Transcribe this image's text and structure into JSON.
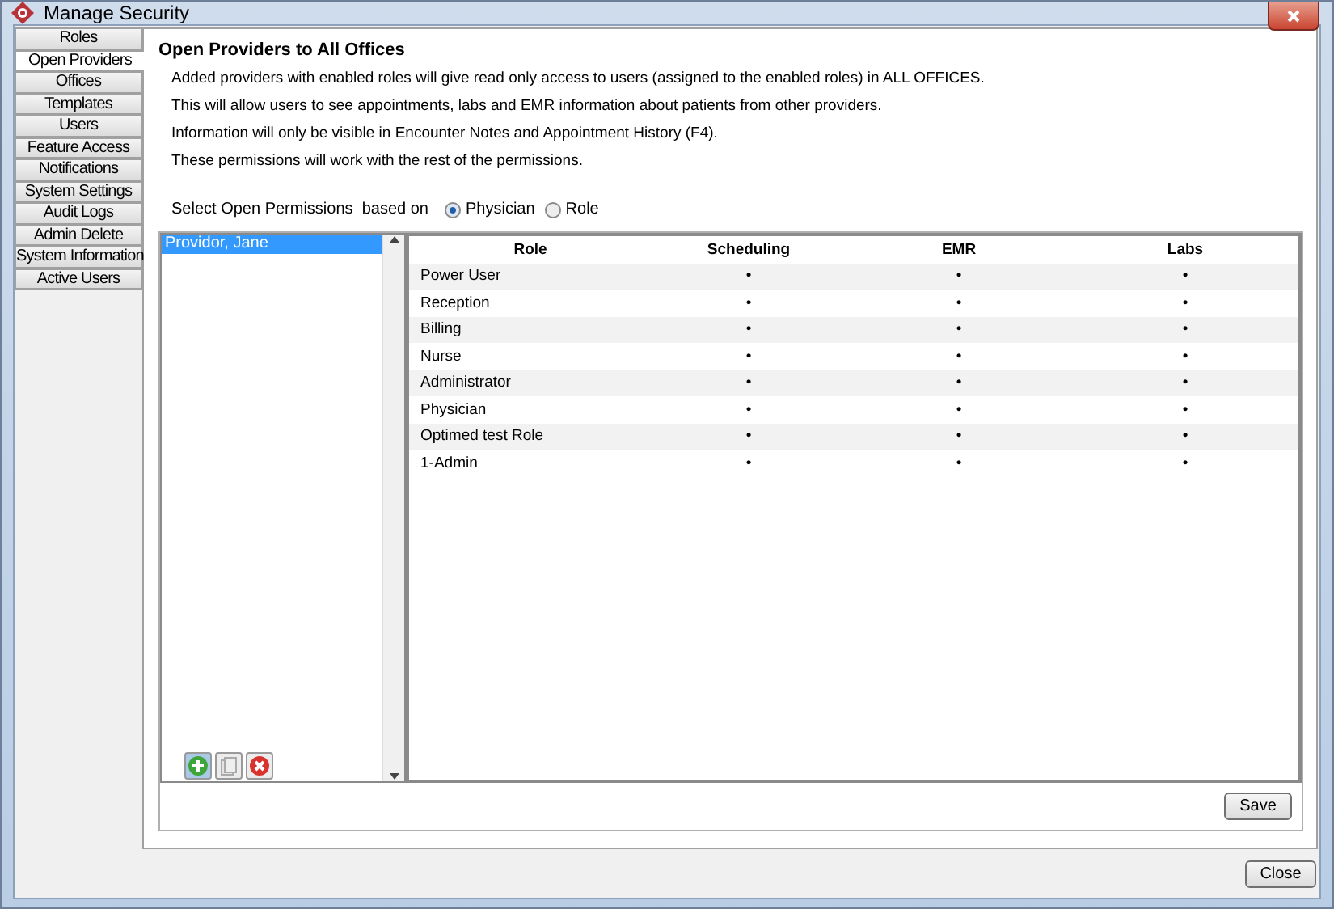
{
  "window": {
    "title": "Manage Security"
  },
  "sidebar": {
    "items": [
      {
        "label": "Roles",
        "selected": false
      },
      {
        "label": "Open Providers",
        "selected": true
      },
      {
        "label": "Offices",
        "selected": false
      },
      {
        "label": "Templates",
        "selected": false
      },
      {
        "label": "Users",
        "selected": false
      },
      {
        "label": "Feature Access",
        "selected": false
      },
      {
        "label": "Notifications",
        "selected": false
      },
      {
        "label": "System Settings",
        "selected": false
      },
      {
        "label": "Audit Logs",
        "selected": false
      },
      {
        "label": "Admin Delete",
        "selected": false
      },
      {
        "label": "System Information",
        "selected": false
      },
      {
        "label": "Active Users",
        "selected": false
      }
    ]
  },
  "heading": "Open Providers to All Offices",
  "notes": [
    "Added providers with enabled roles will give read only access to users (assigned to the enabled roles) in ALL OFFICES.",
    "This will allow users to see appointments, labs and EMR information about patients from other providers.",
    "Information will only be visible in Encounter Notes and Appointment History (F4).",
    "These permissions will work with the rest of the permissions."
  ],
  "permissions_basis": {
    "label": "Select Open Permissions  based on",
    "options": [
      {
        "label": "Physician",
        "selected": true
      },
      {
        "label": "Role",
        "selected": false
      }
    ]
  },
  "providers": {
    "items": [
      {
        "label": "Providor, Jane",
        "selected": true
      }
    ]
  },
  "table": {
    "columns": [
      "Role",
      "Scheduling",
      "EMR",
      "Labs"
    ],
    "rows": [
      {
        "cells": [
          "Power User",
          "•",
          "•",
          "•"
        ]
      },
      {
        "cells": [
          "Reception",
          "•",
          "•",
          "•"
        ]
      },
      {
        "cells": [
          "Billing",
          "•",
          "•",
          "•"
        ]
      },
      {
        "cells": [
          "Nurse",
          "•",
          "•",
          "•"
        ]
      },
      {
        "cells": [
          "Administrator",
          "•",
          "•",
          "•"
        ]
      },
      {
        "cells": [
          "Physician",
          "•",
          "•",
          "•"
        ]
      },
      {
        "cells": [
          "Optimed test Role",
          "•",
          "•",
          "•"
        ]
      },
      {
        "cells": [
          "1-Admin",
          "•",
          "•",
          "•"
        ]
      }
    ]
  },
  "buttons": {
    "save": "Save",
    "close": "Close"
  }
}
